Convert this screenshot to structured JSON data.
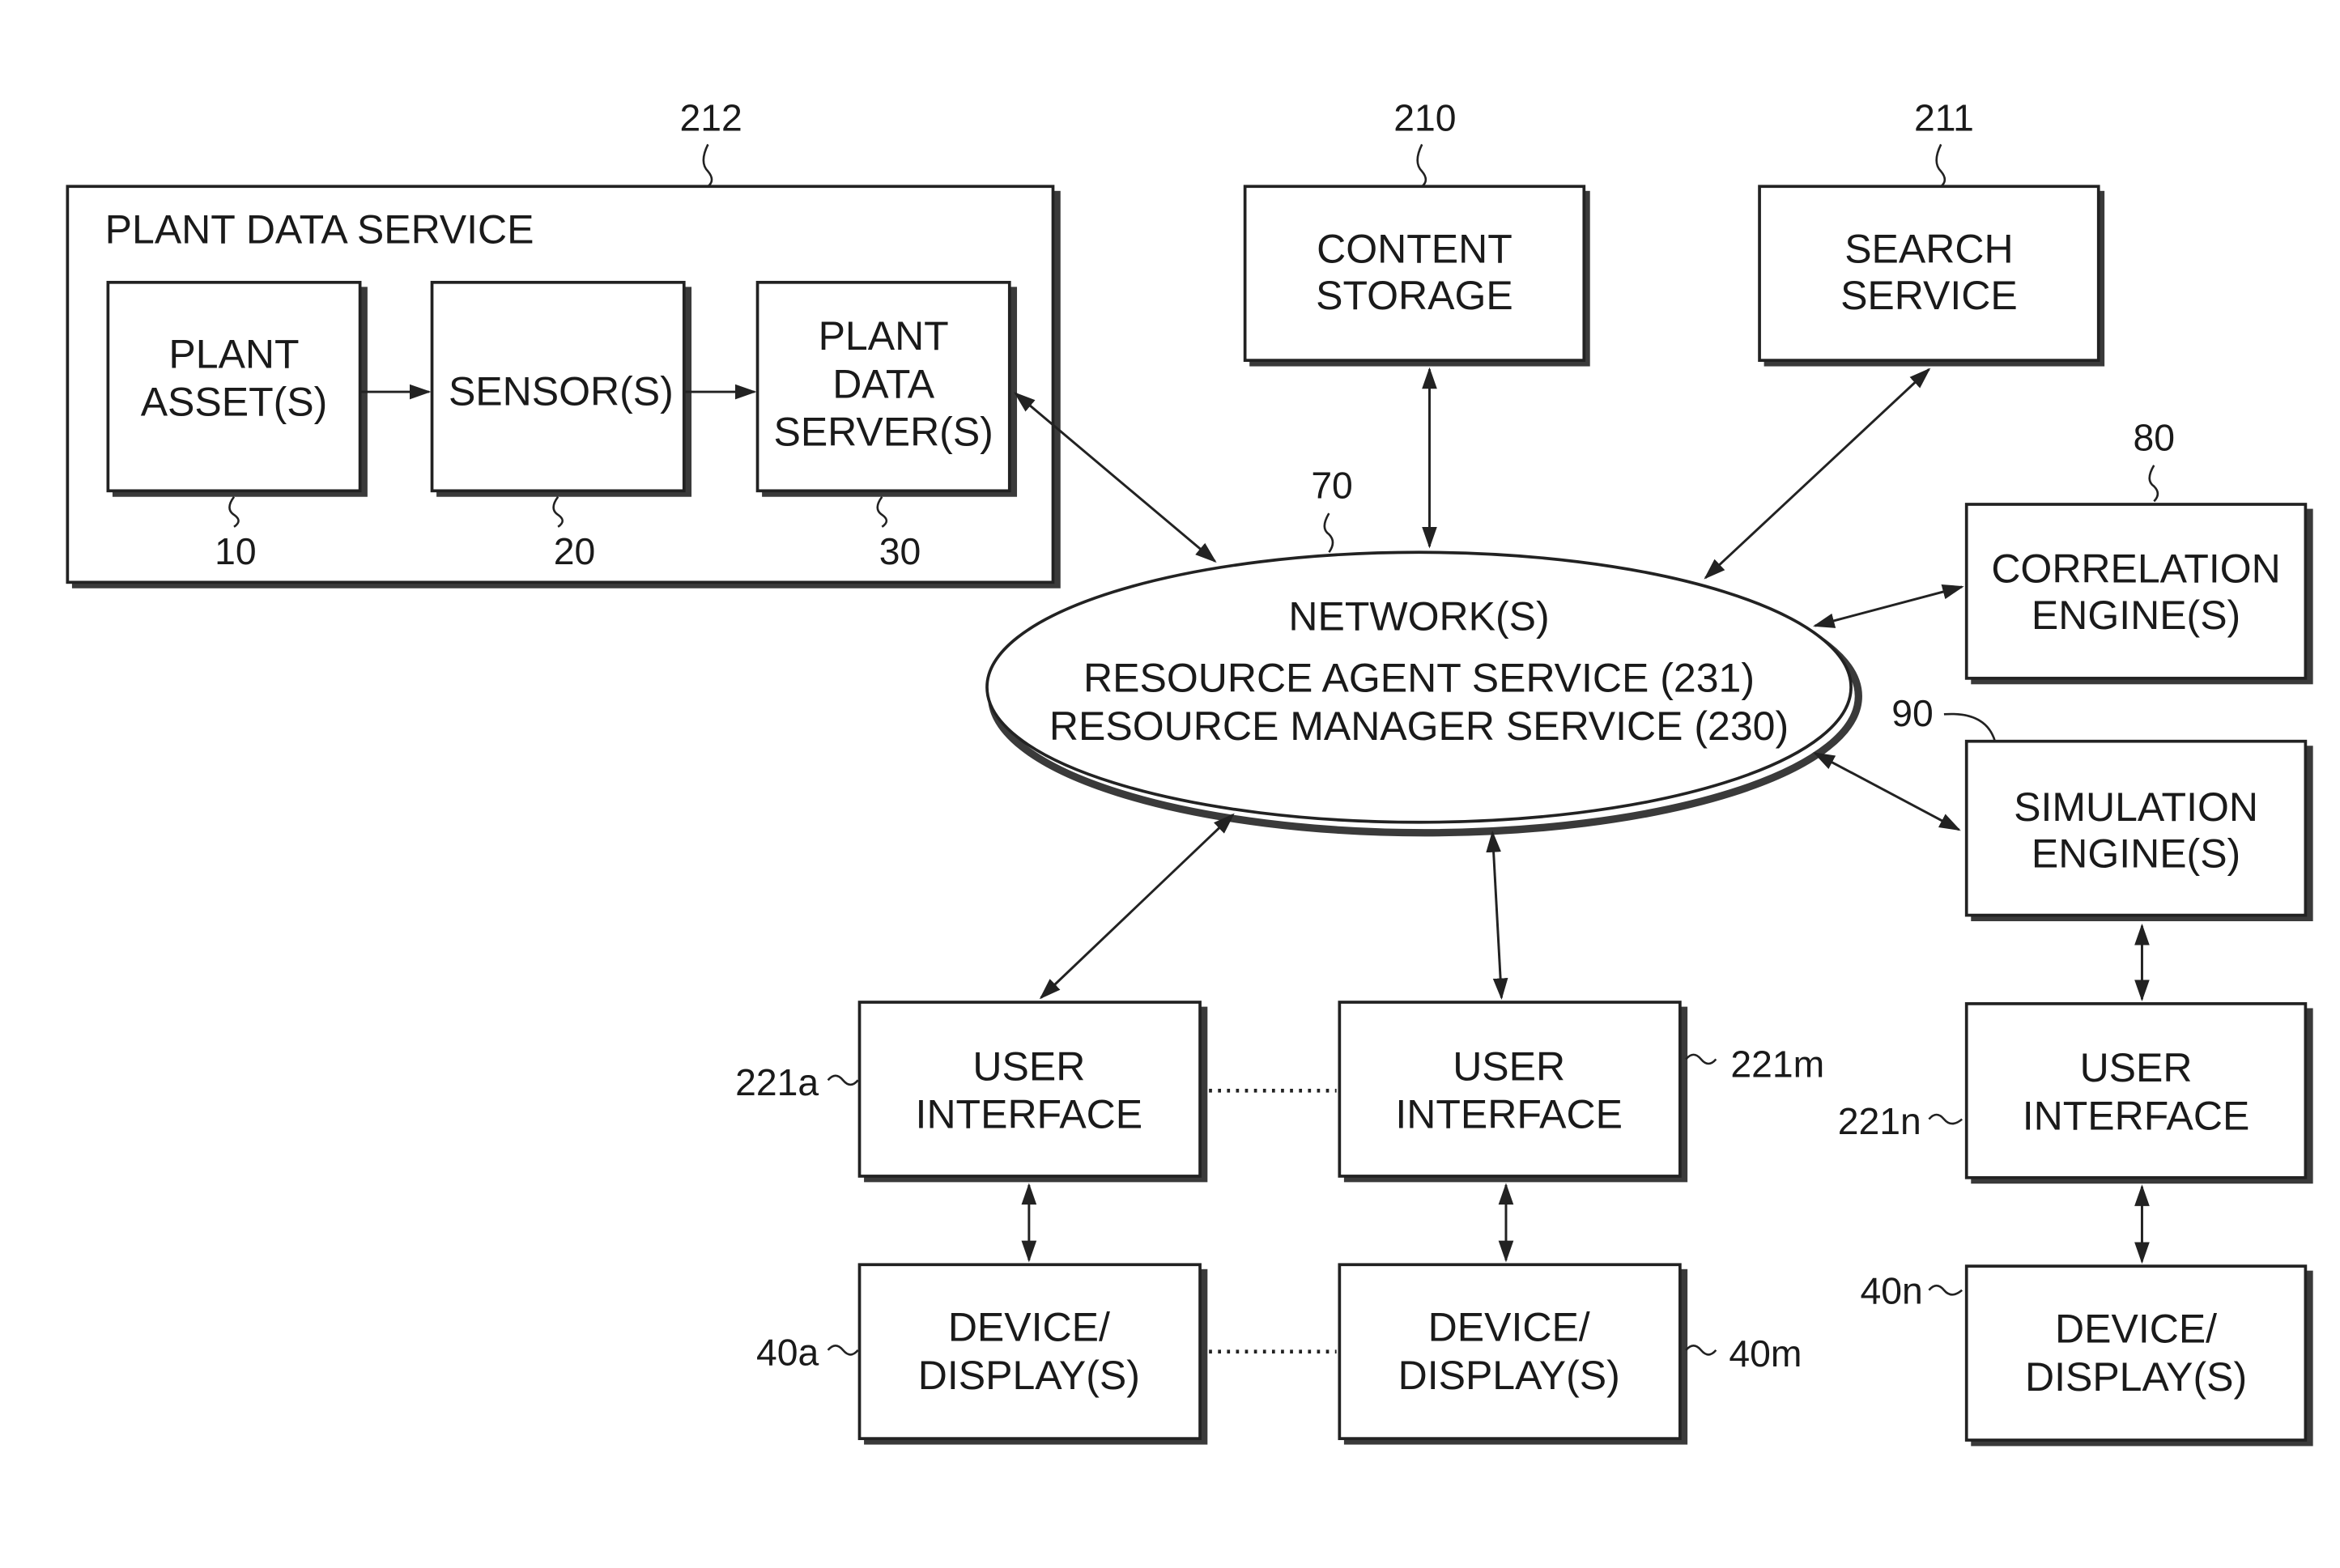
{
  "diagram": {
    "type": "block-diagram",
    "plant_data_service": {
      "ref": "212",
      "title": "PLANT DATA SERVICE",
      "plant_assets": {
        "ref": "10",
        "line1": "PLANT",
        "line2": "ASSET(S)"
      },
      "sensors": {
        "ref": "20",
        "line1": "SENSOR(S)"
      },
      "plant_data_servers": {
        "ref": "30",
        "line1": "PLANT",
        "line2": "DATA",
        "line3": "SERVER(S)"
      }
    },
    "content_storage": {
      "ref": "210",
      "line1": "CONTENT",
      "line2": "STORAGE"
    },
    "search_service": {
      "ref": "211",
      "line1": "SEARCH",
      "line2": "SERVICE"
    },
    "network": {
      "ref": "70",
      "line1": "NETWORK(S)",
      "line2": "RESOURCE AGENT SERVICE (231)",
      "line3": "RESOURCE MANAGER SERVICE (230)"
    },
    "correlation_engine": {
      "ref": "80",
      "line1": "CORRELATION",
      "line2": "ENGINE(S)"
    },
    "simulation_engine": {
      "ref": "90",
      "line1": "SIMULATION",
      "line2": "ENGINE(S)"
    },
    "user_interfaces": [
      {
        "ref": "221a",
        "line1": "USER",
        "line2": "INTERFACE"
      },
      {
        "ref": "221m",
        "line1": "USER",
        "line2": "INTERFACE"
      },
      {
        "ref": "221n",
        "line1": "USER",
        "line2": "INTERFACE"
      }
    ],
    "devices": [
      {
        "ref": "40a",
        "line1": "DEVICE/",
        "line2": "DISPLAY(S)"
      },
      {
        "ref": "40m",
        "line1": "DEVICE/",
        "line2": "DISPLAY(S)"
      },
      {
        "ref": "40n",
        "line1": "DEVICE/",
        "line2": "DISPLAY(S)"
      }
    ],
    "edges": [
      {
        "from": "PLANT ASSET(S)",
        "to": "SENSOR(S)",
        "direction": "one-way"
      },
      {
        "from": "SENSOR(S)",
        "to": "PLANT DATA SERVER(S)",
        "direction": "one-way"
      },
      {
        "from": "PLANT DATA SERVER(S)",
        "to": "NETWORK(S)",
        "direction": "two-way"
      },
      {
        "from": "CONTENT STORAGE",
        "to": "NETWORK(S)",
        "direction": "two-way"
      },
      {
        "from": "SEARCH SERVICE",
        "to": "NETWORK(S)",
        "direction": "two-way"
      },
      {
        "from": "CORRELATION ENGINE(S)",
        "to": "NETWORK(S)",
        "direction": "two-way"
      },
      {
        "from": "SIMULATION ENGINE(S)",
        "to": "NETWORK(S)",
        "direction": "two-way"
      },
      {
        "from": "USER INTERFACE 221a",
        "to": "NETWORK(S)",
        "direction": "two-way"
      },
      {
        "from": "USER INTERFACE 221m",
        "to": "NETWORK(S)",
        "direction": "two-way"
      },
      {
        "from": "SIMULATION ENGINE(S)",
        "to": "USER INTERFACE 221n",
        "direction": "two-way"
      },
      {
        "from": "USER INTERFACE 221a",
        "to": "DEVICE/DISPLAY(S) 40a",
        "direction": "two-way"
      },
      {
        "from": "USER INTERFACE 221m",
        "to": "DEVICE/DISPLAY(S) 40m",
        "direction": "two-way"
      },
      {
        "from": "USER INTERFACE 221n",
        "to": "DEVICE/DISPLAY(S) 40n",
        "direction": "two-way"
      },
      {
        "from": "USER INTERFACE 221a",
        "to": "USER INTERFACE 221m",
        "direction": "dotted"
      },
      {
        "from": "DEVICE/DISPLAY(S) 40a",
        "to": "DEVICE/DISPLAY(S) 40m",
        "direction": "dotted"
      }
    ]
  }
}
